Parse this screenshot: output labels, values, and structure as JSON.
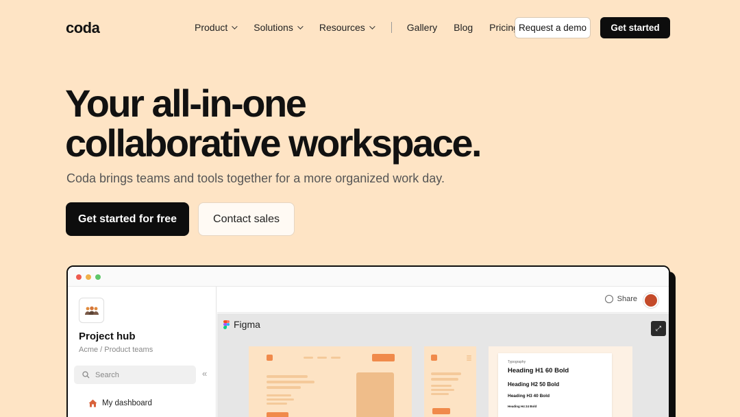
{
  "nav": {
    "logo": "coda",
    "dropdowns": [
      {
        "label": "Product"
      },
      {
        "label": "Solutions"
      },
      {
        "label": "Resources"
      }
    ],
    "links": [
      {
        "label": "Gallery"
      },
      {
        "label": "Blog"
      },
      {
        "label": "Pricing"
      }
    ],
    "demo_button": "Request a demo",
    "get_started_button": "Get started"
  },
  "hero": {
    "title_line1": "Your all-in-one",
    "title_line2": "collaborative workspace.",
    "subtitle": "Coda brings teams and tools together for a more organized work day.",
    "primary_cta": "Get started for free",
    "secondary_cta": "Contact sales"
  },
  "app": {
    "window_dots": [
      "#ee5b4f",
      "#f0b14a",
      "#5ec76a"
    ],
    "sidebar": {
      "hub_title": "Project hub",
      "hub_path": "Acme / Product teams",
      "search_placeholder": "Search",
      "collapse_glyph": "«",
      "items": [
        {
          "label": "My dashboard",
          "icon": "house-icon"
        }
      ]
    },
    "topbar": {
      "share_label": "Share"
    },
    "embed": {
      "label": "Figma",
      "typography": {
        "caption": "Typography",
        "h1": "Heading H1 60 Bold",
        "h2": "Heading H2 50 Bold",
        "h3": "Heading H3 40 Bold",
        "h4": "Heading H4 24 Bold"
      }
    }
  },
  "colors": {
    "background": "#fee4c5",
    "dark": "#0d0d0d",
    "accent_orange": "#f08a4b"
  }
}
